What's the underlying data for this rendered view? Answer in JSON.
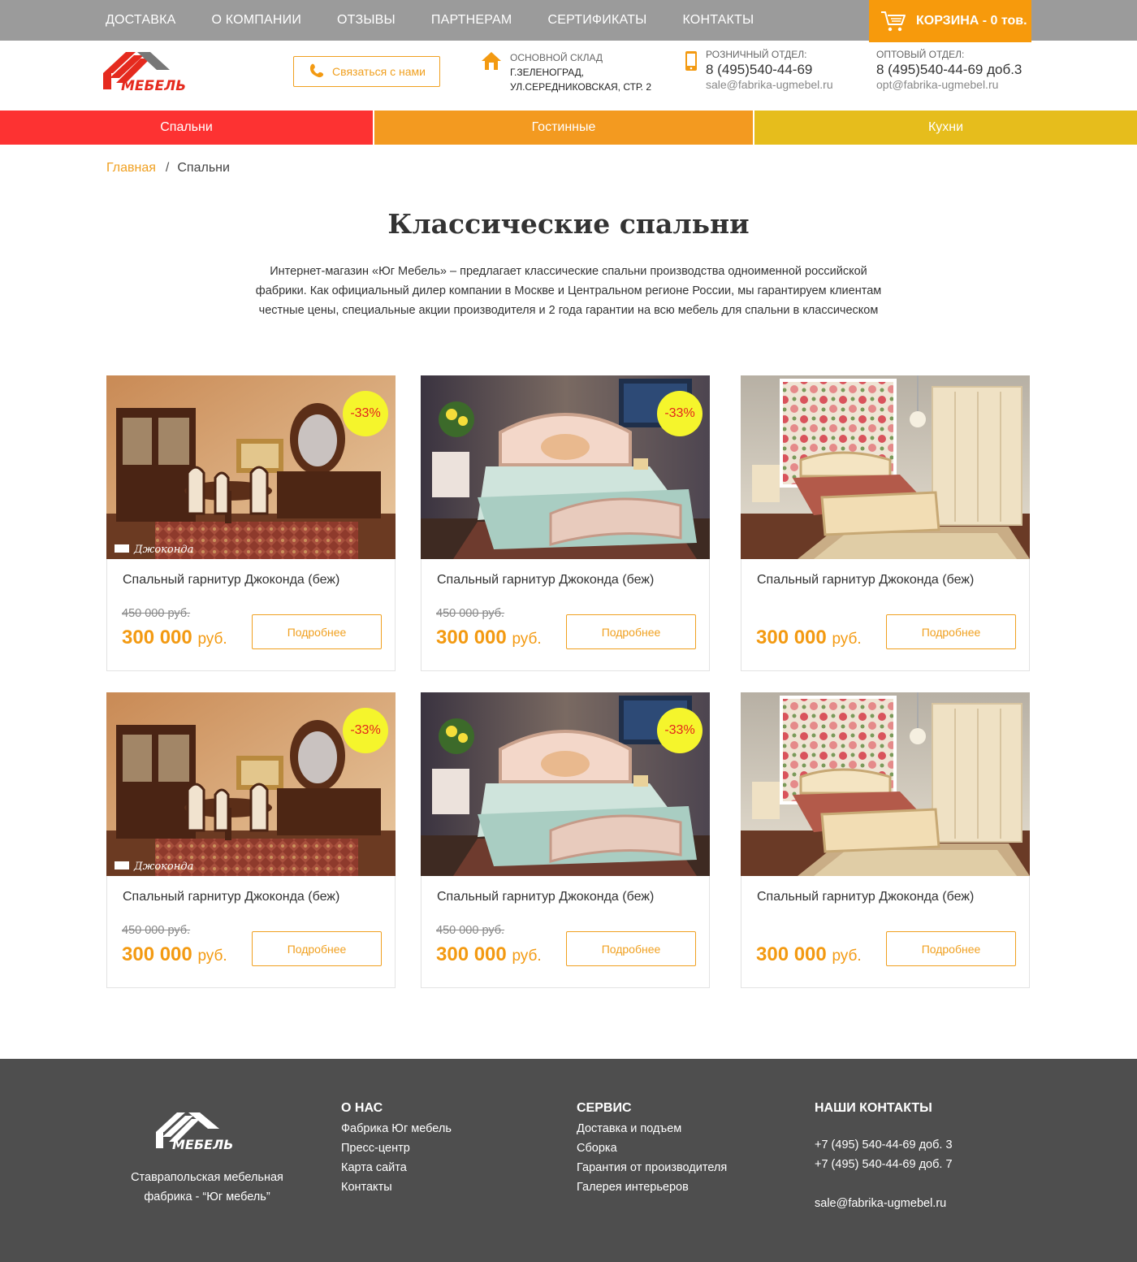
{
  "topnav": {
    "items": [
      "ДОСТАВКА",
      "О КОМПАНИИ",
      "ОТЗЫВЫ",
      "ПАРТНЕРАМ",
      "СЕРТИФИКАТЫ",
      "КОНТАКТЫ"
    ],
    "cart_label": "КОРЗИНА - 0 тов."
  },
  "header": {
    "contact_button": "Связаться с нами",
    "warehouse_label": "ОСНОВНОЙ СКЛАД",
    "warehouse_line1": "Г.ЗЕЛЕНОГРАД,",
    "warehouse_line2": "УЛ.СЕРЕДНИКОВСКАЯ, СТР. 2",
    "retail_label": "РОЗНИЧНЫЙ ОТДЕЛ:",
    "retail_phone": "8 (495)540-44-69",
    "retail_email": "sale@fabrika-ugmebel.ru",
    "wholesale_label": "ОПТОВЫЙ ОТДЕЛ:",
    "wholesale_phone": "8 (495)540-44-69 доб.3",
    "wholesale_email": "opt@fabrika-ugmebel.ru"
  },
  "categories": [
    "Спальни",
    "Гостинные",
    "Кухни"
  ],
  "breadcrumb": {
    "home": "Главная",
    "current": "Спальни"
  },
  "page": {
    "title": "Классические спальни",
    "intro": "Интернет-магазин «Юг Мебель» – предлагает классические спальни производства одноименной российской фабрики. Как официальный дилер компании в Москве и Центральном регионе России, мы гарантируем клиентам честные цены, специальные акции производителя и 2 года гарантии на всю мебель для спальни в классическом"
  },
  "products": [
    {
      "name": "Спальный гарнитур Джоконда (беж)",
      "badge": "-33%",
      "old_price": "450 000 руб.",
      "price": "300 000",
      "currency": "руб.",
      "button": "Подробнее",
      "image": "dining-room",
      "caption": "Джоконда"
    },
    {
      "name": "Спальный гарнитур Джоконда (беж)",
      "badge": "-33%",
      "old_price": "450 000 руб.",
      "price": "300 000",
      "currency": "руб.",
      "button": "Подробнее",
      "image": "bedroom-classic",
      "caption": ""
    },
    {
      "name": "Спальный гарнитур Джоконда (беж)",
      "badge": "",
      "old_price": "",
      "price": "300 000",
      "currency": "руб.",
      "button": "Подробнее",
      "image": "bedroom-floral",
      "caption": ""
    },
    {
      "name": "Спальный гарнитур Джоконда (беж)",
      "badge": "-33%",
      "old_price": "450 000 руб.",
      "price": "300 000",
      "currency": "руб.",
      "button": "Подробнее",
      "image": "dining-room",
      "caption": "Джоконда"
    },
    {
      "name": "Спальный гарнитур Джоконда (беж)",
      "badge": "-33%",
      "old_price": "450 000 руб.",
      "price": "300 000",
      "currency": "руб.",
      "button": "Подробнее",
      "image": "bedroom-classic",
      "caption": ""
    },
    {
      "name": "Спальный гарнитур Джоконда (беж)",
      "badge": "",
      "old_price": "",
      "price": "300 000",
      "currency": "руб.",
      "button": "Подробнее",
      "image": "bedroom-floral",
      "caption": ""
    }
  ],
  "footer": {
    "logo_text": "МЕБЕЛЬ",
    "description": "Ставрапольская мебельная фабрика - “Юг мебель”",
    "about_title": "О НАС",
    "about_links": [
      "Фабрика Юг мебель",
      "Пресс-центр",
      "Карта сайта",
      "Контакты"
    ],
    "service_title": "СЕРВИС",
    "service_links": [
      "Доставка и подъем",
      "Сборка",
      "Гарантия от производителя",
      "Галерея интерьеров"
    ],
    "contacts_title": "НАШИ КОНТАКТЫ",
    "contact_phone1": "+7 (495) 540-44-69 доб. 3",
    "contact_phone2": "+7 (495) 540-44-69 доб. 7",
    "contact_email": "sale@fabrika-ugmebel.ru"
  },
  "colors": {
    "accent": "#f39a12",
    "topbar": "#9b9b9b",
    "cart": "#f79a0c",
    "cat_bedrooms": "#fd3232",
    "cat_living": "#f39a20",
    "cat_kitchens": "#e6bd1c",
    "badge": "#f5f52c",
    "footer": "#4e4e4e"
  }
}
